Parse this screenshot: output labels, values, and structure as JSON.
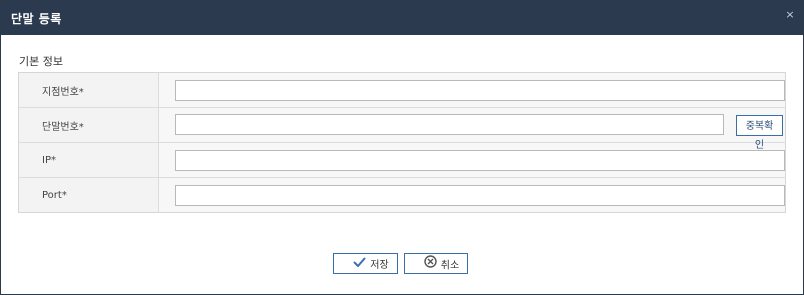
{
  "dialog": {
    "title": "단말 등록",
    "close_glyph": "×",
    "section_title": "기본 정보",
    "fields": [
      {
        "label": "지점번호*",
        "value": ""
      },
      {
        "label": "단말번호*",
        "value": "",
        "action_label": "중복확인"
      },
      {
        "label": "IP*",
        "value": ""
      },
      {
        "label": "Port*",
        "value": ""
      }
    ],
    "buttons": {
      "save_label": "저장",
      "cancel_label": "취소"
    }
  },
  "icons": {
    "close": "close-icon",
    "save": "check-icon",
    "cancel": "cancel-circle-icon"
  },
  "colors": {
    "titlebar": "#2b3a4f",
    "button_border": "#3b6ea5",
    "save_icon": "#3d6fb0"
  }
}
